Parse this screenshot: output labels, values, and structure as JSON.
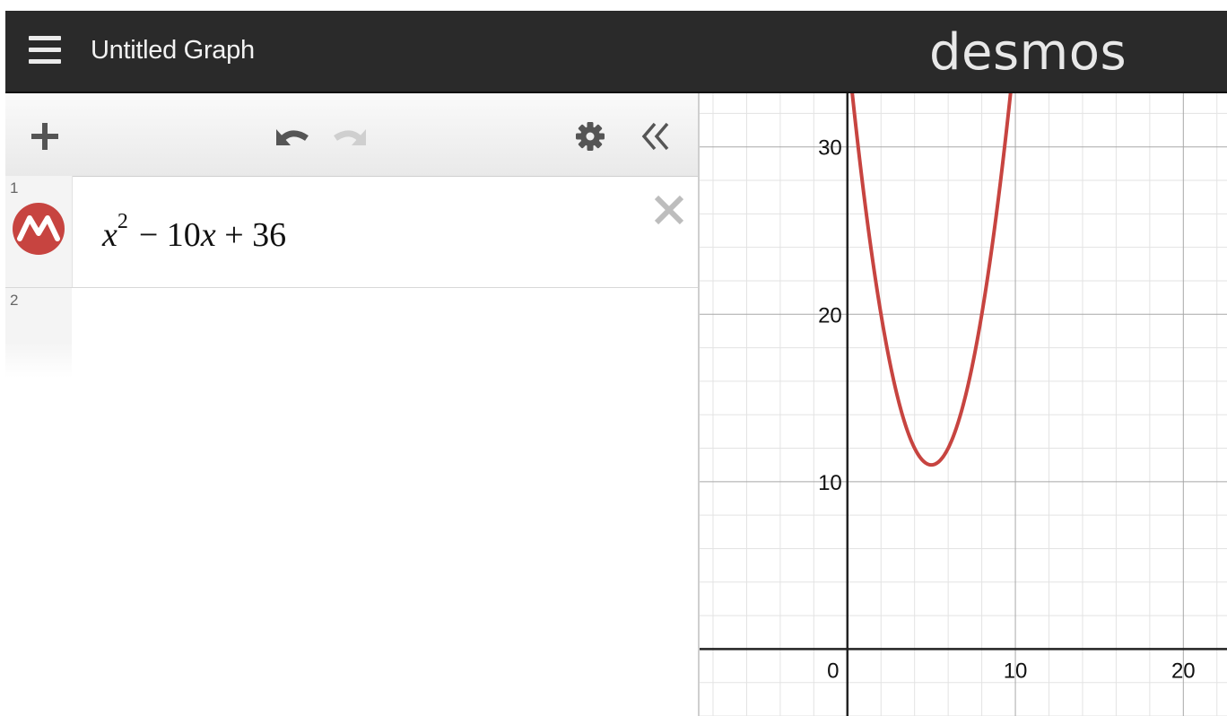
{
  "header": {
    "title": "Untitled Graph",
    "logo": "desmos",
    "icons": {
      "menu": "hamburger-menu-icon"
    }
  },
  "toolbar": {
    "icons": {
      "add": "plus-icon",
      "undo": "undo-icon",
      "redo": "redo-icon",
      "settings": "gear-icon",
      "collapse": "double-chevron-left-icon"
    }
  },
  "expressions": [
    {
      "number": "1",
      "latex_parts": [
        "x",
        "2",
        "− 10",
        "x",
        " + 36"
      ],
      "color": "#c74440",
      "icon": "curve-icon"
    },
    {
      "number": "2"
    }
  ],
  "graph": {
    "x_ticks": [
      "0",
      "10",
      "20"
    ],
    "y_ticks": [
      "10",
      "20",
      "30"
    ],
    "x_range": [
      -8.8,
      22.6
    ],
    "y_range": [
      -4,
      33.2
    ],
    "curve_color": "#c74440"
  },
  "chart_data": {
    "type": "line",
    "title": "",
    "xlabel": "",
    "ylabel": "",
    "xlim": [
      -8.8,
      22.6
    ],
    "ylim": [
      -4,
      33.2
    ],
    "x_tick_labels": [
      "0",
      "10",
      "20"
    ],
    "y_tick_labels": [
      "10",
      "20",
      "30"
    ],
    "grid": true,
    "series": [
      {
        "expression": "x^2 - 10x + 36",
        "coefficients": [
          1,
          -10,
          36
        ],
        "color": "#c74440"
      }
    ]
  }
}
